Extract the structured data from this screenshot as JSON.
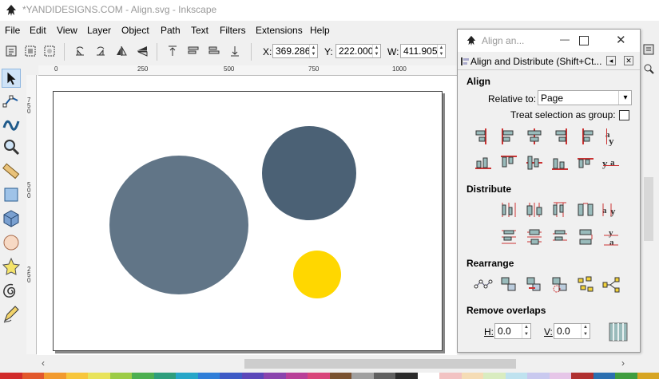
{
  "window": {
    "title": "*YANDIDESIGNS.COM - Align.svg - Inkscape"
  },
  "menu": [
    "File",
    "Edit",
    "View",
    "Layer",
    "Object",
    "Path",
    "Text",
    "Filters",
    "Extensions",
    "Help"
  ],
  "toolbar": {
    "x_label": "X:",
    "x_value": "369.286",
    "y_label": "Y:",
    "y_value": "222.000",
    "w_label": "W:",
    "w_value": "411.905"
  },
  "ruler": {
    "h_ticks": [
      "0",
      "250",
      "500",
      "750",
      "1000"
    ],
    "v_ticks": [
      "750",
      "500",
      "250"
    ]
  },
  "canvas": {
    "shapes": [
      {
        "name": "large-circle",
        "color": "#617587"
      },
      {
        "name": "medium-circle",
        "color": "#4b6175"
      },
      {
        "name": "small-circle",
        "color": "#ffd700"
      }
    ]
  },
  "dialog": {
    "title": "Align an...",
    "tab_label": "Align and Distribute (Shift+Ct...",
    "align_header": "Align",
    "relative_to_label": "Relative to:",
    "relative_to_value": "Page",
    "treat_group_label": "Treat selection as group:",
    "distribute_header": "Distribute",
    "rearrange_header": "Rearrange",
    "remove_overlaps_header": "Remove overlaps",
    "h_label": "H:",
    "h_value": "0.0",
    "v_label": "V:",
    "v_value": "0.0"
  },
  "palette": [
    "#d12b2b",
    "#e2582c",
    "#f29a2e",
    "#f7c63c",
    "#e8e35b",
    "#9ccc46",
    "#4caf50",
    "#2e9e7c",
    "#26a6c8",
    "#2f7ed8",
    "#3d5ac6",
    "#5b47b9",
    "#8a44ad",
    "#b83f98",
    "#d8457a",
    "#7a5230",
    "#a0a0a0",
    "#606060",
    "#2a2a2a",
    "#ffffff",
    "#f2c3c3",
    "#f5dcb5",
    "#d9ecc0",
    "#bfe2ef",
    "#c9c9ef",
    "#e6c6e8",
    "#b03030",
    "#2b6fb0",
    "#3f9d3f",
    "#d7a523"
  ]
}
